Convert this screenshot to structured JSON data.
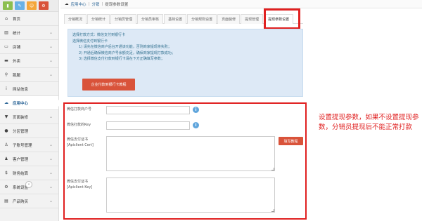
{
  "colors": {
    "accent_red": "#e02020",
    "button_red": "#d9533a",
    "info_bg": "#dde9f6",
    "link_blue": "#2a6496"
  },
  "shortcuts": [
    {
      "icon": "bar-chart-icon",
      "color": "#8cbf4f"
    },
    {
      "icon": "pencil-icon",
      "color": "#68b1e6"
    },
    {
      "icon": "users-icon",
      "color": "#f4a63a"
    },
    {
      "icon": "gear-icon",
      "color": "#d9533a"
    }
  ],
  "sidebar": {
    "items": [
      {
        "label": "首页",
        "icon": "home-icon"
      },
      {
        "label": "统计",
        "icon": "chart-icon"
      },
      {
        "label": "店铺",
        "icon": "monitor-icon"
      },
      {
        "label": "外卖",
        "icon": "car-icon"
      },
      {
        "label": "跑腿",
        "icon": "bike-icon"
      },
      {
        "label": "网站信息",
        "icon": "info-icon"
      },
      {
        "label": "应用中心",
        "icon": "cloud-icon"
      },
      {
        "label": "页面装修",
        "icon": "shirt-icon"
      },
      {
        "label": "分区管理",
        "icon": "circle-icon"
      },
      {
        "label": "子账号管理",
        "icon": "user-icon"
      },
      {
        "label": "客户管理",
        "icon": "user-group-icon"
      },
      {
        "label": "财务结算",
        "icon": "dollar-icon"
      },
      {
        "label": "系统设置",
        "icon": "gear-icon"
      },
      {
        "label": "产品购买",
        "icon": "cart-icon"
      }
    ],
    "collapse_icon": "double-chevron-left-icon"
  },
  "breadcrumb": {
    "items": [
      "应用中心",
      "分销",
      "提现参数设置"
    ]
  },
  "tabs": [
    "分销概况",
    "分销统计",
    "分销员管理",
    "分销员审核",
    "基础设置",
    "分销规则设置",
    "页面装修",
    "提现管理",
    "提现参数设置"
  ],
  "info": {
    "line1": "选择打款方式：微信支付到银行卡",
    "line2": "选择微信支付到银行卡",
    "step1": "1) 请先在微信商户后台开通该功能，否则商家提现将失败；",
    "step2": "2) 开通后确保微信商户号余额充足，确保商家提现打款成功；",
    "step3": "3) 选择微信支付打款到银行卡请在下方正确填写参数；",
    "button": "企业付款到银行卡教程"
  },
  "form": {
    "merchant_id_label": "微信打款商户号",
    "key_label": "微信打款的Key",
    "cert_label_1": "微信支付证书",
    "cert_label_2": "[Apiclient Cert]",
    "upload_button": "填写教程",
    "key_cert_label_1": "微信支付证书",
    "key_cert_label_2": "[Apiclient Key]",
    "merchant_id_value": "",
    "key_value": "",
    "cert_value": "",
    "key_cert_value": ""
  },
  "note": "设置提现参数，如果不设置提现参数，分销员提现后不能正常打款"
}
